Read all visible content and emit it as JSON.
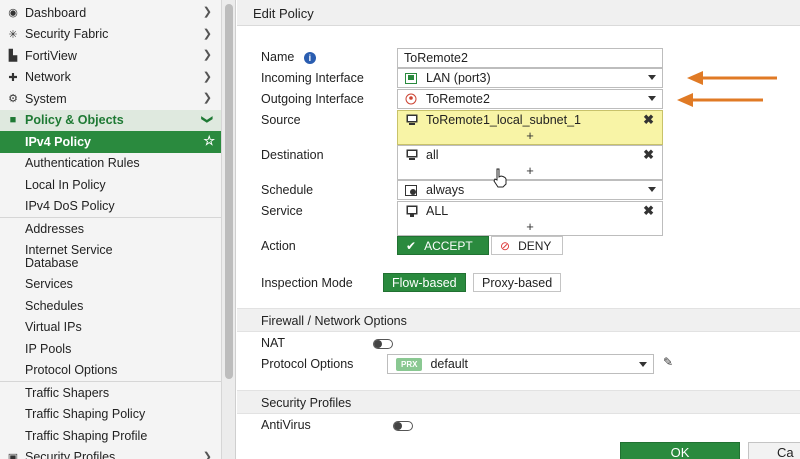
{
  "sidebar": {
    "top_items": [
      {
        "label": "Dashboard",
        "icon": "dashboard-icon",
        "glyph": "◆"
      },
      {
        "label": "Security Fabric",
        "icon": "security-fabric-icon",
        "glyph": "✳"
      },
      {
        "label": "FortiView",
        "icon": "fortiview-icon",
        "glyph": "▟"
      },
      {
        "label": "Network",
        "icon": "network-icon",
        "glyph": "✚"
      },
      {
        "label": "System",
        "icon": "gear-icon",
        "glyph": "⚙"
      }
    ],
    "section": {
      "label": "Policy & Objects",
      "icon": "policy-icon",
      "glyph": "▪"
    },
    "sub_items": [
      {
        "label": "IPv4 Policy",
        "active": true
      },
      {
        "label": "Authentication Rules"
      },
      {
        "label": "Local In Policy"
      },
      {
        "label": "IPv4 DoS Policy"
      },
      {
        "label": "Addresses"
      },
      {
        "label": "Internet Service Database"
      },
      {
        "label": "Services"
      },
      {
        "label": "Schedules"
      },
      {
        "label": "Virtual IPs"
      },
      {
        "label": "IP Pools"
      },
      {
        "label": "Protocol Options"
      },
      {
        "label": "Traffic Shapers"
      },
      {
        "label": "Traffic Shaping Policy"
      },
      {
        "label": "Traffic Shaping Profile"
      }
    ],
    "bottom_item": {
      "label": "Security Profiles",
      "icon": "security-profiles-icon",
      "glyph": "▣"
    }
  },
  "header": {
    "title": "Edit Policy"
  },
  "form": {
    "name": {
      "label": "Name",
      "value": "ToRemote2"
    },
    "incoming": {
      "label": "Incoming Interface",
      "value": "LAN (port3)"
    },
    "outgoing": {
      "label": "Outgoing Interface",
      "value": "ToRemote2"
    },
    "source": {
      "label": "Source",
      "value": "ToRemote1_local_subnet_1"
    },
    "destination": {
      "label": "Destination",
      "value": "all"
    },
    "schedule": {
      "label": "Schedule",
      "value": "always"
    },
    "service": {
      "label": "Service",
      "value": "ALL"
    },
    "action": {
      "label": "Action",
      "accept": "ACCEPT",
      "deny": "DENY"
    },
    "inspection": {
      "label": "Inspection Mode",
      "flow": "Flow-based",
      "proxy": "Proxy-based"
    }
  },
  "firewall_section": {
    "title": "Firewall / Network Options",
    "nat_label": "NAT",
    "protocol_label": "Protocol Options",
    "protocol_badge": "PRX",
    "protocol_value": "default"
  },
  "security_section": {
    "title": "Security Profiles",
    "antivirus_label": "AntiVirus"
  },
  "buttons": {
    "ok": "OK",
    "cancel": "Ca"
  },
  "plus": "+",
  "colors": {
    "accent": "#2a8a3e",
    "highlight": "#f8f4a6",
    "annotation_arrow": "#e07a25"
  }
}
